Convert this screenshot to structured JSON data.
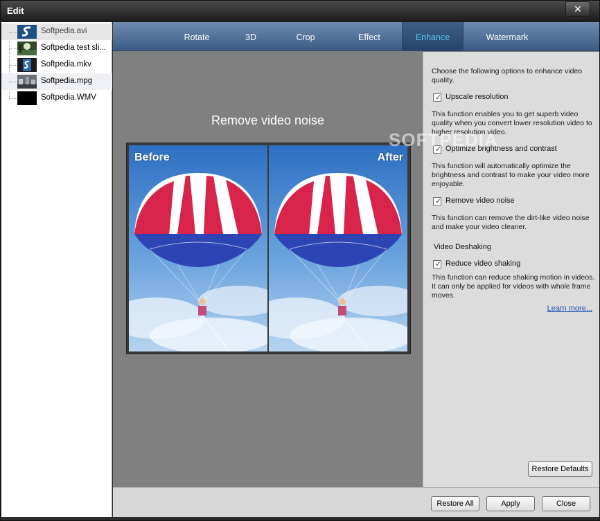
{
  "window": {
    "title": "Edit",
    "close_glyph": "✕"
  },
  "files": [
    {
      "name": "Softpedia.avi",
      "thumb": "softpedia-logo"
    },
    {
      "name": "Softpedia test sli...",
      "thumb": "landscape"
    },
    {
      "name": "Softpedia.mkv",
      "thumb": "softpedia-logo"
    },
    {
      "name": "Softpedia.mpg",
      "thumb": "street"
    },
    {
      "name": "Softpedia.WMV",
      "thumb": "black"
    }
  ],
  "tabs": [
    {
      "label": "Rotate",
      "active": false
    },
    {
      "label": "3D",
      "active": false
    },
    {
      "label": "Crop",
      "active": false
    },
    {
      "label": "Effect",
      "active": false
    },
    {
      "label": "Enhance",
      "active": true
    },
    {
      "label": "Watermark",
      "active": false
    }
  ],
  "preview": {
    "title": "Remove video noise",
    "before_label": "Before",
    "after_label": "After"
  },
  "options": {
    "intro": "Choose the following options to enhance video quality.",
    "upscale": {
      "label": "Upscale resolution",
      "checked": true,
      "desc": "This function enables you to get superb video quality when you convert lower resolution video to higher resolution video."
    },
    "brightness": {
      "label": "Optimize brightness and contrast",
      "checked": true,
      "desc": "This function will automatically optimize the brightness and contrast to make your video more enjoyable."
    },
    "noise": {
      "label": "Remove video noise",
      "checked": true,
      "desc": "This function can remove the dirt-like video noise and make your video cleaner."
    },
    "deshaking_heading": "Video Deshaking",
    "shaking": {
      "label": "Reduce video shaking",
      "checked": true,
      "desc": "This function can reduce shaking motion in videos. It can only be applied for videos with whole frame moves."
    },
    "learn_more": "Learn more...",
    "restore_defaults": "Restore Defaults",
    "tick": "✓"
  },
  "watermark_text": "SOFTPEDIA",
  "footer": {
    "restore_all": "Restore All",
    "apply": "Apply",
    "close": "Close"
  },
  "colors": {
    "accent_tab": "#56c8f5",
    "tab_bar": "#3a5b84",
    "link": "#1f4fb3"
  }
}
